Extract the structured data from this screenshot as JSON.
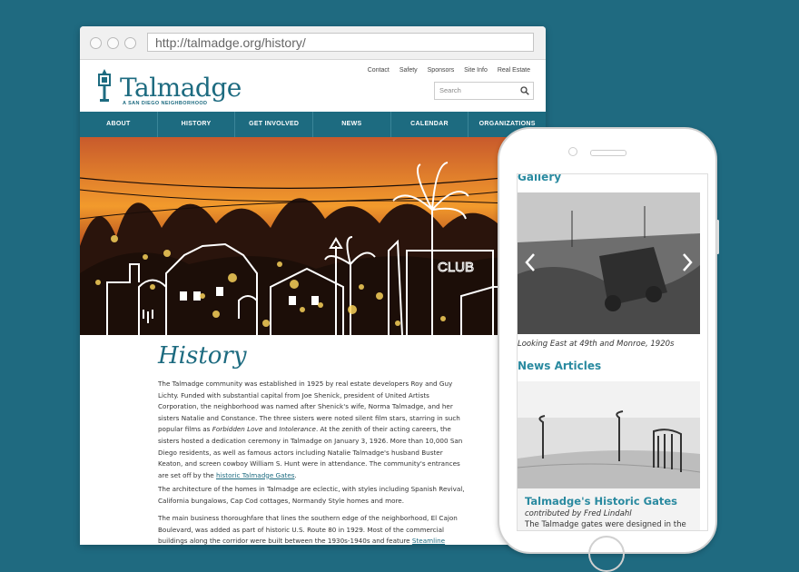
{
  "browser": {
    "url": "http://talmadge.org/history/"
  },
  "site": {
    "logo_name": "Talmadge",
    "logo_tagline": "A SAN DIEGO NEIGHBORHOOD",
    "utility_links": [
      "Contact",
      "Safety",
      "Sponsors",
      "Site Info",
      "Real Estate"
    ],
    "search_placeholder": "Search",
    "nav": [
      "ABOUT",
      "HISTORY",
      "GET INVOLVED",
      "NEWS",
      "CALENDAR",
      "ORGANIZATIONS"
    ],
    "hero_sign": "CLUB"
  },
  "content": {
    "title": "History",
    "p1_a": "The Talmadge community was established in 1925 by real estate developers Roy and Guy Lichty. Funded with substantial capital from Joe Shenick, president of United Artists Corporation, the neighborhood was named after Shenick's wife, Norma Talmadge, and her sisters Natalie and Constance. The three sisters were noted silent film stars, starring in such popular films as ",
    "p1_film1": "Forbidden Love",
    "p1_and": " and ",
    "p1_film2": "Intolerance",
    "p1_b": ". At the zenith of their acting careers, the sisters hosted a dedication ceremony in Talmadge on January 3, 1926. More than 10,000 San Diego residents, as well as famous actors including Natalie Talmadge's husband Buster Keaton, and screen cowboy William S. Hunt were in attendance. The community's entrances are set off by the ",
    "p1_link": "historic Talmadge Gates",
    "p1_end": ".",
    "p2": "The architecture of the homes in Talmadge are eclectic, with styles including Spanish Revival, California bungalows, Cap Cod cottages, Normandy Style homes and more.",
    "p3_a": "The main business thoroughfare that lines the southern edge of the neighborhood, El Cajon Boulevard, was added as part of historic U.S. Route 80 in 1929. Most of the commercial buildings along the corridor were built between the 1930s-1940s and feature ",
    "p3_link": "Steamline"
  },
  "phone": {
    "gallery_heading": "Gallery",
    "gallery_caption": "Looking East at 49th and Monroe, 1920s",
    "news_heading": "News Articles",
    "article_title": "Talmadge's Historic Gates",
    "article_author": "contributed by Fred Lindahl",
    "article_excerpt": "The Talmadge gates were designed in the"
  },
  "colors": {
    "background": "#1f6a80",
    "brand": "#1d6b80",
    "accent": "#2a8aa0"
  }
}
